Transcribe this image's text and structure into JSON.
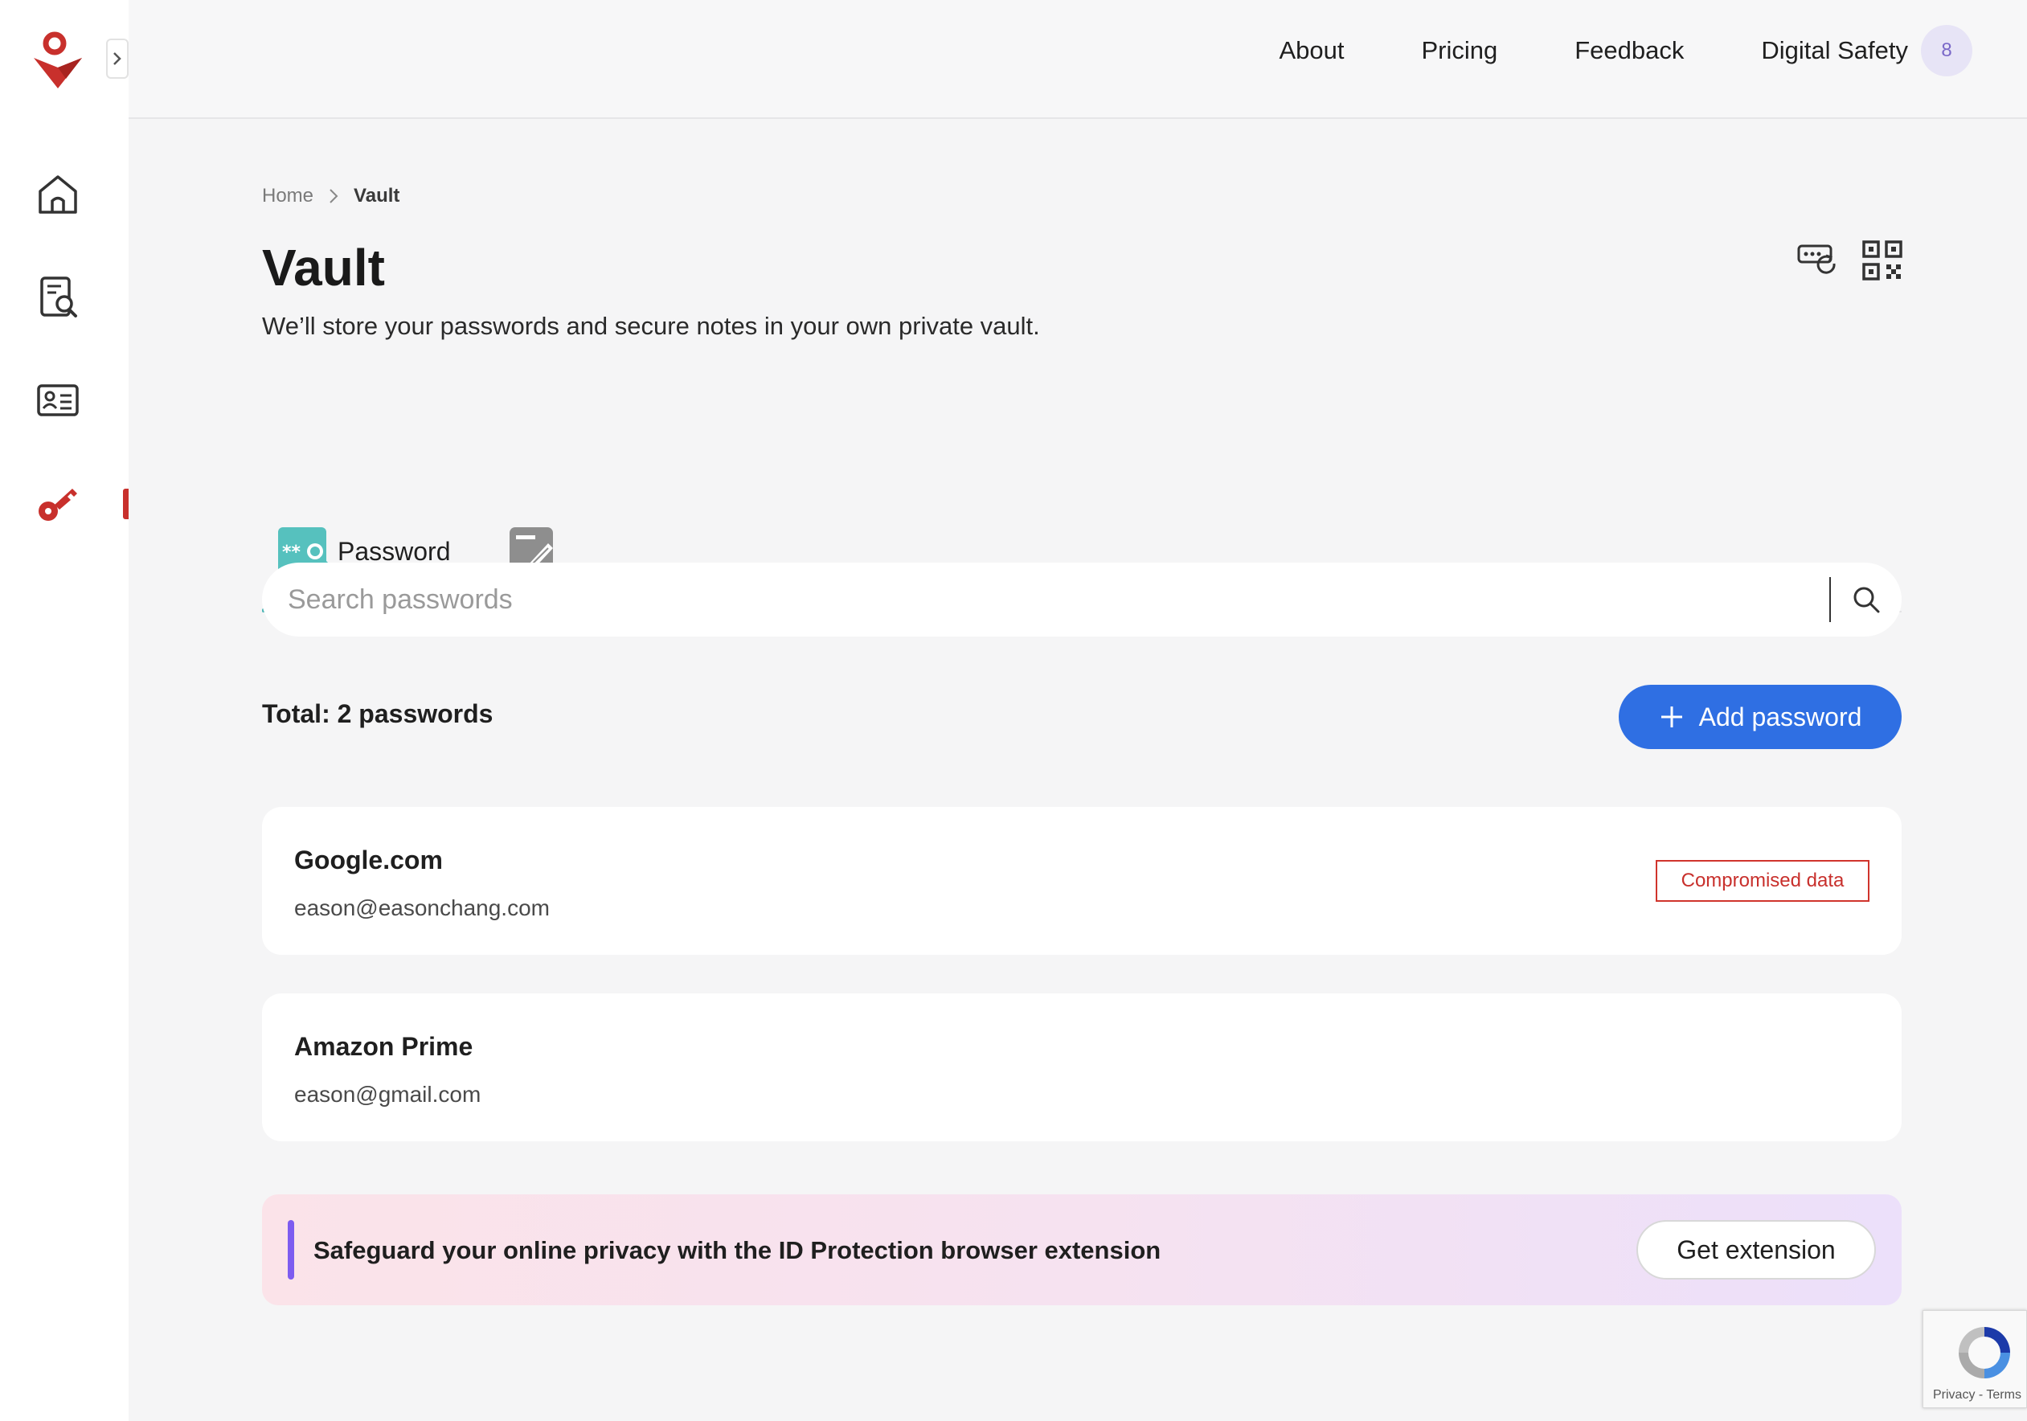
{
  "sidebar": {
    "items": [
      {
        "name": "home",
        "icon": "home-icon"
      },
      {
        "name": "scan",
        "icon": "document-search-icon"
      },
      {
        "name": "identity",
        "icon": "id-card-icon"
      },
      {
        "name": "vault",
        "icon": "key-icon",
        "active": true
      }
    ]
  },
  "header": {
    "nav": [
      "About",
      "Pricing",
      "Feedback",
      "Digital Safety"
    ],
    "avatar_initial": "8"
  },
  "breadcrumb": {
    "home": "Home",
    "current": "Vault"
  },
  "page": {
    "title": "Vault",
    "subtitle": "We’ll store your passwords and secure notes in your own private vault."
  },
  "tabs": {
    "password_label": "Password"
  },
  "search": {
    "placeholder": "Search passwords",
    "value": ""
  },
  "summary": {
    "total_label": "Total: 2 passwords"
  },
  "actions": {
    "add_label": "Add password"
  },
  "passwords": [
    {
      "site": "Google.com",
      "email": "eason@easonchang.com",
      "badge": "Compromised data"
    },
    {
      "site": "Amazon Prime",
      "email": "eason@gmail.com",
      "badge": ""
    }
  ],
  "promo": {
    "text": "Safeguard your online privacy with the ID Protection browser extension",
    "button_label": "Get extension"
  },
  "recaptcha": {
    "links": "Privacy - Terms"
  },
  "colors": {
    "brand": "#c8302c",
    "primary": "#2f6fe3",
    "tab_accent": "#4fb6b6",
    "promo_accent": "#7d5cf0"
  }
}
